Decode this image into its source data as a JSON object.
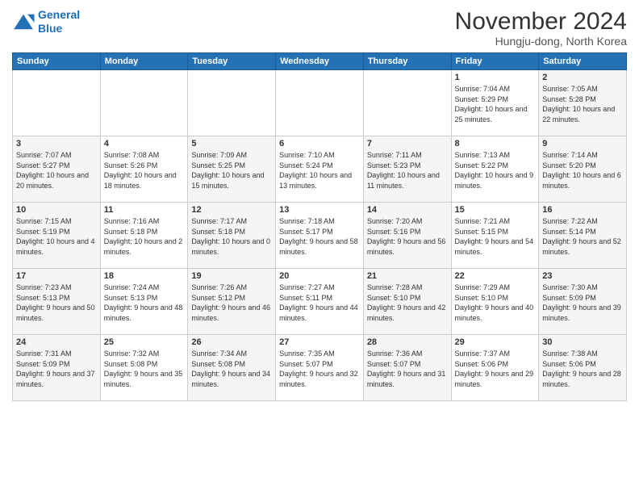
{
  "header": {
    "logo_line1": "General",
    "logo_line2": "Blue",
    "month": "November 2024",
    "location": "Hungju-dong, North Korea"
  },
  "weekdays": [
    "Sunday",
    "Monday",
    "Tuesday",
    "Wednesday",
    "Thursday",
    "Friday",
    "Saturday"
  ],
  "weeks": [
    [
      {
        "day": "",
        "info": ""
      },
      {
        "day": "",
        "info": ""
      },
      {
        "day": "",
        "info": ""
      },
      {
        "day": "",
        "info": ""
      },
      {
        "day": "",
        "info": ""
      },
      {
        "day": "1",
        "info": "Sunrise: 7:04 AM\nSunset: 5:29 PM\nDaylight: 10 hours and 25 minutes."
      },
      {
        "day": "2",
        "info": "Sunrise: 7:05 AM\nSunset: 5:28 PM\nDaylight: 10 hours and 22 minutes."
      }
    ],
    [
      {
        "day": "3",
        "info": "Sunrise: 7:07 AM\nSunset: 5:27 PM\nDaylight: 10 hours and 20 minutes."
      },
      {
        "day": "4",
        "info": "Sunrise: 7:08 AM\nSunset: 5:26 PM\nDaylight: 10 hours and 18 minutes."
      },
      {
        "day": "5",
        "info": "Sunrise: 7:09 AM\nSunset: 5:25 PM\nDaylight: 10 hours and 15 minutes."
      },
      {
        "day": "6",
        "info": "Sunrise: 7:10 AM\nSunset: 5:24 PM\nDaylight: 10 hours and 13 minutes."
      },
      {
        "day": "7",
        "info": "Sunrise: 7:11 AM\nSunset: 5:23 PM\nDaylight: 10 hours and 11 minutes."
      },
      {
        "day": "8",
        "info": "Sunrise: 7:13 AM\nSunset: 5:22 PM\nDaylight: 10 hours and 9 minutes."
      },
      {
        "day": "9",
        "info": "Sunrise: 7:14 AM\nSunset: 5:20 PM\nDaylight: 10 hours and 6 minutes."
      }
    ],
    [
      {
        "day": "10",
        "info": "Sunrise: 7:15 AM\nSunset: 5:19 PM\nDaylight: 10 hours and 4 minutes."
      },
      {
        "day": "11",
        "info": "Sunrise: 7:16 AM\nSunset: 5:18 PM\nDaylight: 10 hours and 2 minutes."
      },
      {
        "day": "12",
        "info": "Sunrise: 7:17 AM\nSunset: 5:18 PM\nDaylight: 10 hours and 0 minutes."
      },
      {
        "day": "13",
        "info": "Sunrise: 7:18 AM\nSunset: 5:17 PM\nDaylight: 9 hours and 58 minutes."
      },
      {
        "day": "14",
        "info": "Sunrise: 7:20 AM\nSunset: 5:16 PM\nDaylight: 9 hours and 56 minutes."
      },
      {
        "day": "15",
        "info": "Sunrise: 7:21 AM\nSunset: 5:15 PM\nDaylight: 9 hours and 54 minutes."
      },
      {
        "day": "16",
        "info": "Sunrise: 7:22 AM\nSunset: 5:14 PM\nDaylight: 9 hours and 52 minutes."
      }
    ],
    [
      {
        "day": "17",
        "info": "Sunrise: 7:23 AM\nSunset: 5:13 PM\nDaylight: 9 hours and 50 minutes."
      },
      {
        "day": "18",
        "info": "Sunrise: 7:24 AM\nSunset: 5:13 PM\nDaylight: 9 hours and 48 minutes."
      },
      {
        "day": "19",
        "info": "Sunrise: 7:26 AM\nSunset: 5:12 PM\nDaylight: 9 hours and 46 minutes."
      },
      {
        "day": "20",
        "info": "Sunrise: 7:27 AM\nSunset: 5:11 PM\nDaylight: 9 hours and 44 minutes."
      },
      {
        "day": "21",
        "info": "Sunrise: 7:28 AM\nSunset: 5:10 PM\nDaylight: 9 hours and 42 minutes."
      },
      {
        "day": "22",
        "info": "Sunrise: 7:29 AM\nSunset: 5:10 PM\nDaylight: 9 hours and 40 minutes."
      },
      {
        "day": "23",
        "info": "Sunrise: 7:30 AM\nSunset: 5:09 PM\nDaylight: 9 hours and 39 minutes."
      }
    ],
    [
      {
        "day": "24",
        "info": "Sunrise: 7:31 AM\nSunset: 5:09 PM\nDaylight: 9 hours and 37 minutes."
      },
      {
        "day": "25",
        "info": "Sunrise: 7:32 AM\nSunset: 5:08 PM\nDaylight: 9 hours and 35 minutes."
      },
      {
        "day": "26",
        "info": "Sunrise: 7:34 AM\nSunset: 5:08 PM\nDaylight: 9 hours and 34 minutes."
      },
      {
        "day": "27",
        "info": "Sunrise: 7:35 AM\nSunset: 5:07 PM\nDaylight: 9 hours and 32 minutes."
      },
      {
        "day": "28",
        "info": "Sunrise: 7:36 AM\nSunset: 5:07 PM\nDaylight: 9 hours and 31 minutes."
      },
      {
        "day": "29",
        "info": "Sunrise: 7:37 AM\nSunset: 5:06 PM\nDaylight: 9 hours and 29 minutes."
      },
      {
        "day": "30",
        "info": "Sunrise: 7:38 AM\nSunset: 5:06 PM\nDaylight: 9 hours and 28 minutes."
      }
    ]
  ]
}
